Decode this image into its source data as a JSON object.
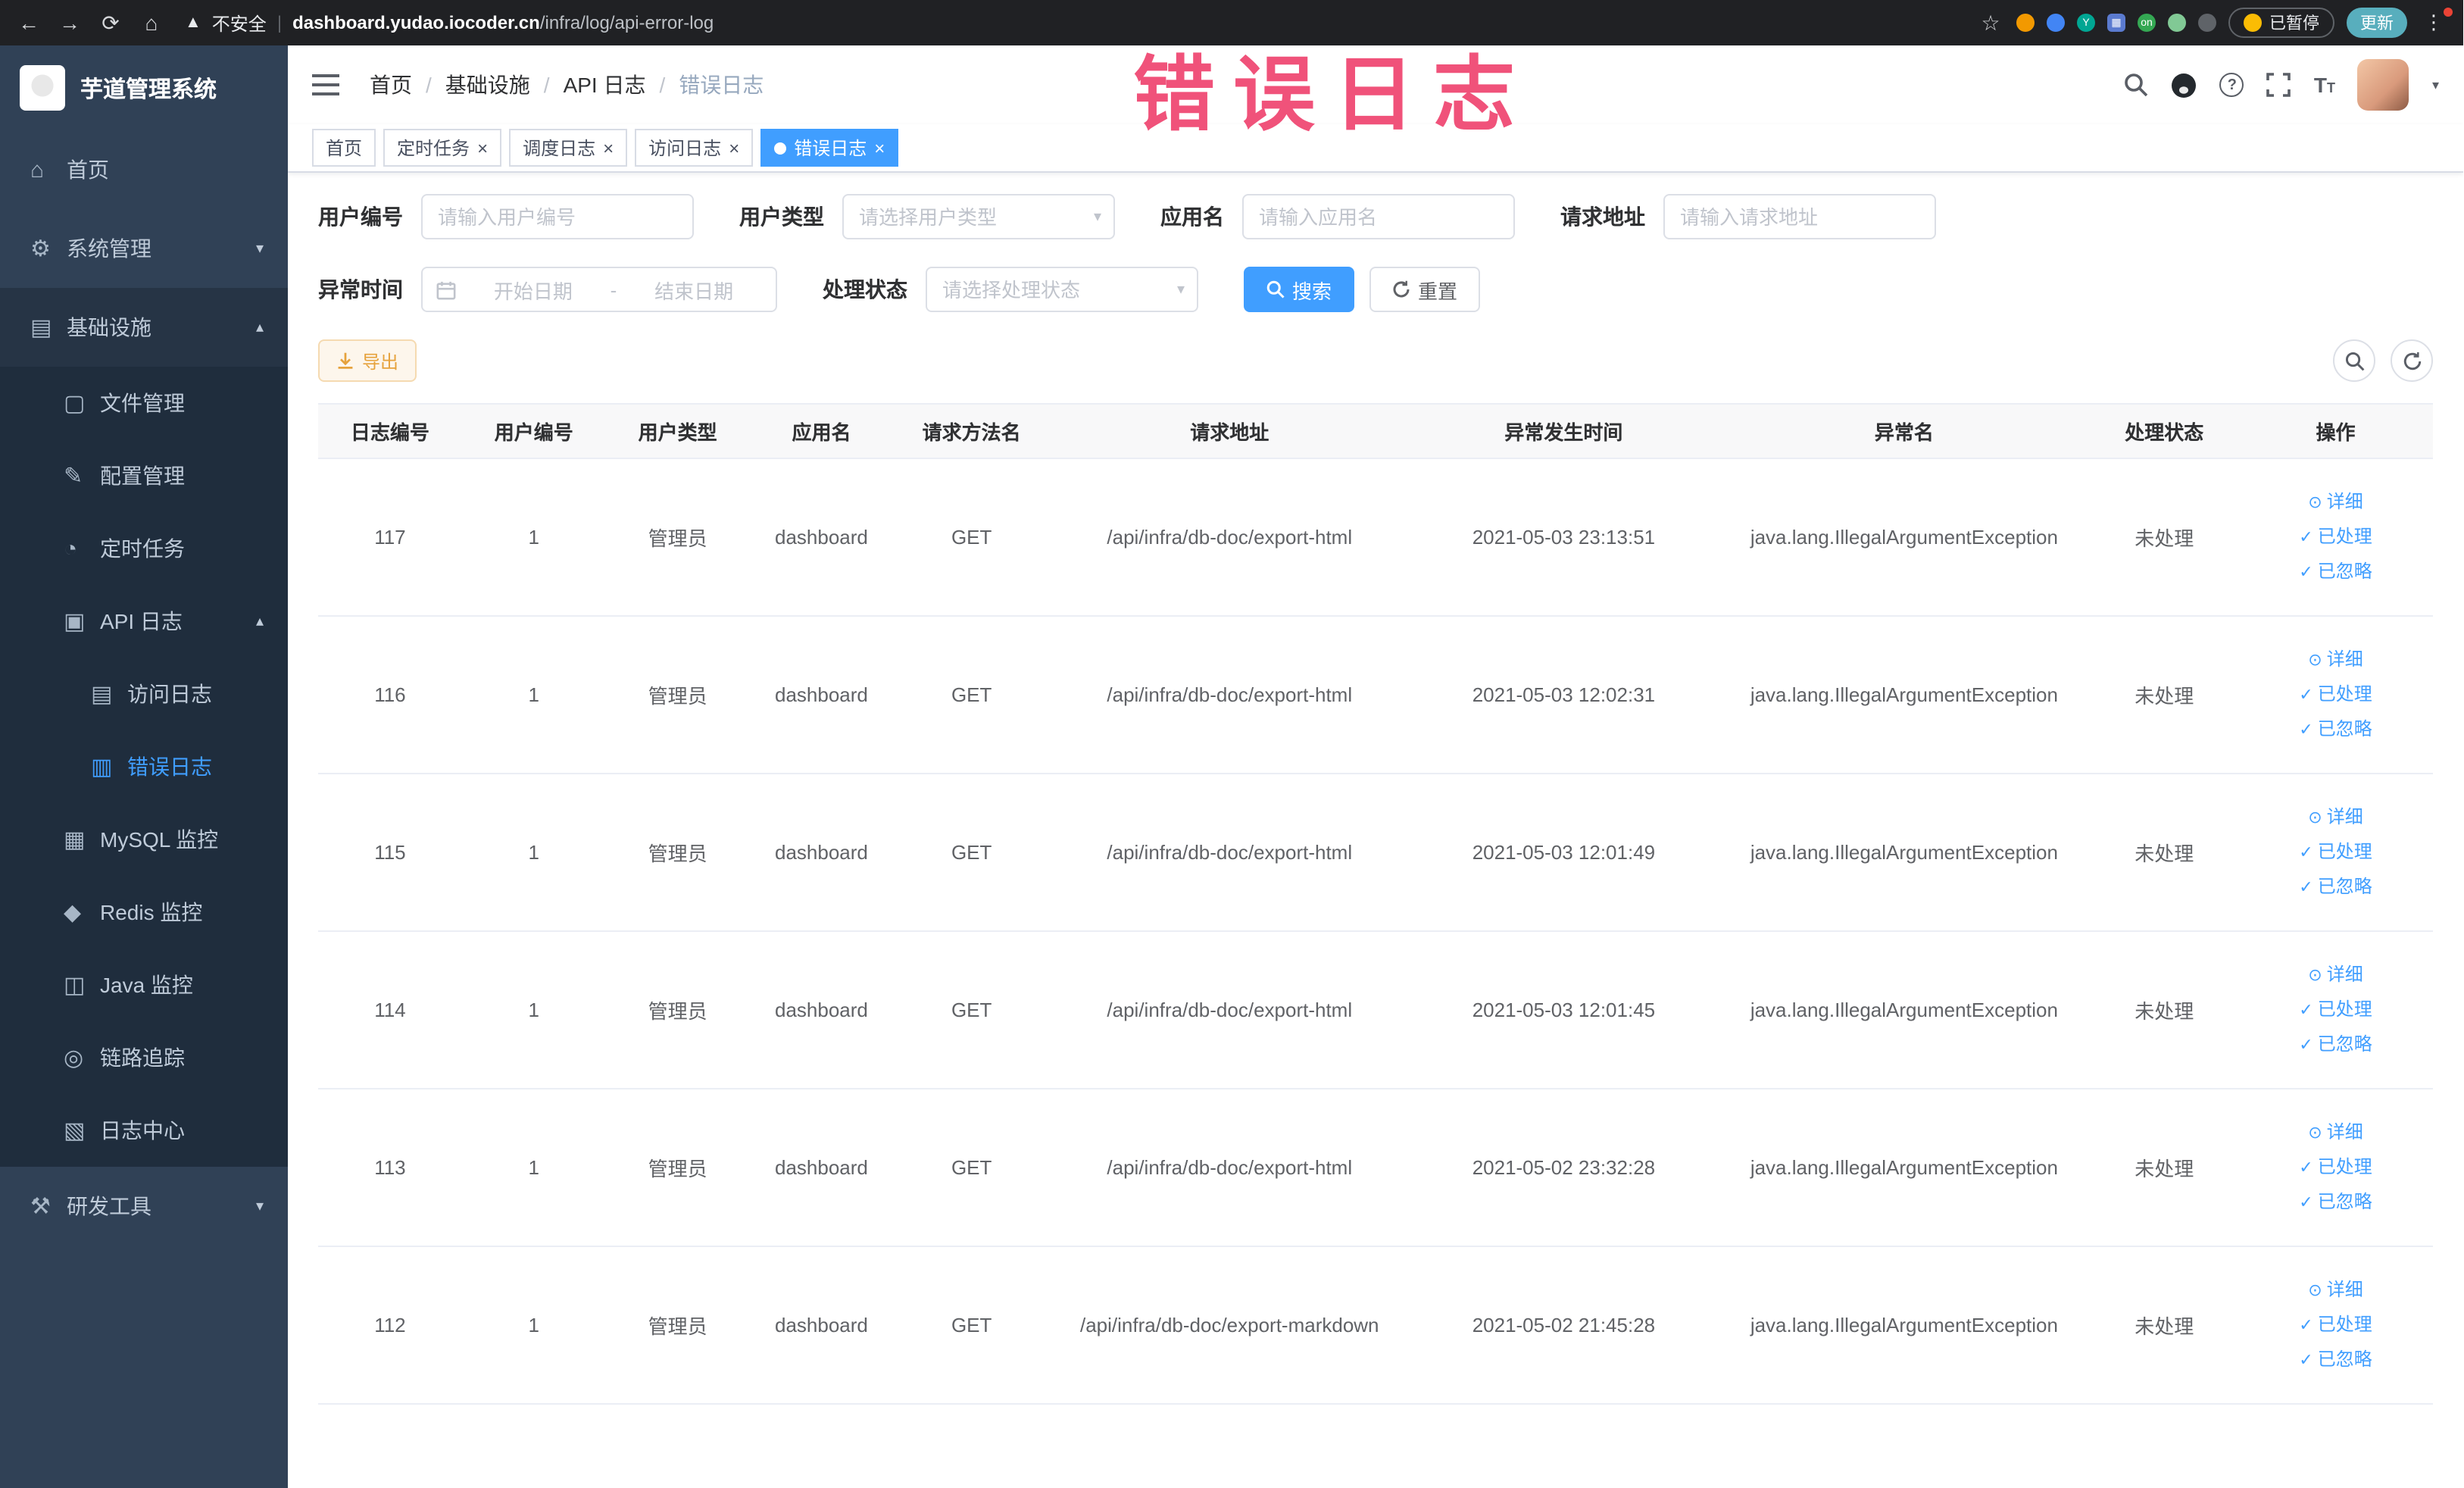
{
  "watermark": "错误日志",
  "browser": {
    "security_label": "不安全",
    "url_host": "dashboard.yudao.iocoder.cn",
    "url_path": "/infra/log/api-error-log",
    "paused_label": "已暂停",
    "update_label": "更新",
    "ext_badge_y": "Y",
    "ext_badge_on": "on"
  },
  "sidebar": {
    "logo_title": "芋道管理系统",
    "menu": [
      {
        "key": "home",
        "label": "首页",
        "icon": "home-icon",
        "level": 1
      },
      {
        "key": "system",
        "label": "系统管理",
        "icon": "gear-icon",
        "level": 1,
        "arrow": "down"
      },
      {
        "key": "infra",
        "label": "基础设施",
        "icon": "infra-icon",
        "level": 1,
        "arrow": "up",
        "open": true
      },
      {
        "key": "file",
        "label": "文件管理",
        "icon": "file-manage-icon",
        "level": 2
      },
      {
        "key": "config",
        "label": "配置管理",
        "icon": "config-icon",
        "level": 2
      },
      {
        "key": "job",
        "label": "定时任务",
        "icon": "timer-icon",
        "level": 2
      },
      {
        "key": "api-log",
        "label": "API 日志",
        "icon": "api-log-icon",
        "level": 2,
        "arrow": "up"
      },
      {
        "key": "access-log",
        "label": "访问日志",
        "icon": "access-log-icon",
        "level": 3
      },
      {
        "key": "error-log",
        "label": "错误日志",
        "icon": "error-log-icon",
        "level": 3,
        "active": true
      },
      {
        "key": "mysql",
        "label": "MySQL 监控",
        "icon": "mysql-icon",
        "level": 2
      },
      {
        "key": "redis",
        "label": "Redis 监控",
        "icon": "redis-icon",
        "level": 2
      },
      {
        "key": "java",
        "label": "Java 监控",
        "icon": "java-icon",
        "level": 2
      },
      {
        "key": "trace",
        "label": "链路追踪",
        "icon": "trace-icon",
        "level": 2
      },
      {
        "key": "log-center",
        "label": "日志中心",
        "icon": "log-center-icon",
        "level": 2
      },
      {
        "key": "devtools",
        "label": "研发工具",
        "icon": "devtools-icon",
        "level": 1,
        "arrow": "down"
      }
    ]
  },
  "header": {
    "breadcrumb": [
      "首页",
      "基础设施",
      "API 日志",
      "错误日志"
    ]
  },
  "tabs": [
    {
      "label": "首页",
      "closable": false,
      "active": false
    },
    {
      "label": "定时任务",
      "closable": true,
      "active": false
    },
    {
      "label": "调度日志",
      "closable": true,
      "active": false
    },
    {
      "label": "访问日志",
      "closable": true,
      "active": false
    },
    {
      "label": "错误日志",
      "closable": true,
      "active": true
    }
  ],
  "filters": {
    "user_id": {
      "label": "用户编号",
      "placeholder": "请输入用户编号"
    },
    "user_type": {
      "label": "用户类型",
      "placeholder": "请选择用户类型"
    },
    "app_name": {
      "label": "应用名",
      "placeholder": "请输入应用名"
    },
    "request_url": {
      "label": "请求地址",
      "placeholder": "请输入请求地址"
    },
    "exception_time": {
      "label": "异常时间",
      "start_placeholder": "开始日期",
      "separator": "-",
      "end_placeholder": "结束日期"
    },
    "process_status": {
      "label": "处理状态",
      "placeholder": "请选择处理状态"
    },
    "search_label": "搜索",
    "reset_label": "重置"
  },
  "toolbar": {
    "export_label": "导出"
  },
  "table": {
    "columns": [
      "日志编号",
      "用户编号",
      "用户类型",
      "应用名",
      "请求方法名",
      "请求地址",
      "异常发生时间",
      "异常名",
      "处理状态",
      "操作"
    ],
    "actions": [
      "详细",
      "已处理",
      "已忽略"
    ],
    "rows": [
      {
        "id": "117",
        "user_id": "1",
        "user_type": "管理员",
        "app": "dashboard",
        "method": "GET",
        "url": "/api/infra/db-doc/export-html",
        "time": "2021-05-03 23:13:51",
        "exception": "java.lang.IllegalArgumentException",
        "status": "未处理"
      },
      {
        "id": "116",
        "user_id": "1",
        "user_type": "管理员",
        "app": "dashboard",
        "method": "GET",
        "url": "/api/infra/db-doc/export-html",
        "time": "2021-05-03 12:02:31",
        "exception": "java.lang.IllegalArgumentException",
        "status": "未处理"
      },
      {
        "id": "115",
        "user_id": "1",
        "user_type": "管理员",
        "app": "dashboard",
        "method": "GET",
        "url": "/api/infra/db-doc/export-html",
        "time": "2021-05-03 12:01:49",
        "exception": "java.lang.IllegalArgumentException",
        "status": "未处理"
      },
      {
        "id": "114",
        "user_id": "1",
        "user_type": "管理员",
        "app": "dashboard",
        "method": "GET",
        "url": "/api/infra/db-doc/export-html",
        "time": "2021-05-03 12:01:45",
        "exception": "java.lang.IllegalArgumentException",
        "status": "未处理"
      },
      {
        "id": "113",
        "user_id": "1",
        "user_type": "管理员",
        "app": "dashboard",
        "method": "GET",
        "url": "/api/infra/db-doc/export-html",
        "time": "2021-05-02 23:32:28",
        "exception": "java.lang.IllegalArgumentException",
        "status": "未处理"
      },
      {
        "id": "112",
        "user_id": "1",
        "user_type": "管理员",
        "app": "dashboard",
        "method": "GET",
        "url": "/api/infra/db-doc/export-markdown",
        "time": "2021-05-02 21:45:28",
        "exception": "java.lang.IllegalArgumentException",
        "status": "未处理"
      }
    ]
  },
  "colors": {
    "accent": "#409EFF",
    "warning": "#E6A23C",
    "sidebar_bg": "#304156",
    "submenu_bg": "#1f2d3d",
    "chrome_bg": "#202124",
    "watermark": "#f0527a",
    "border": "#ebeef5"
  }
}
